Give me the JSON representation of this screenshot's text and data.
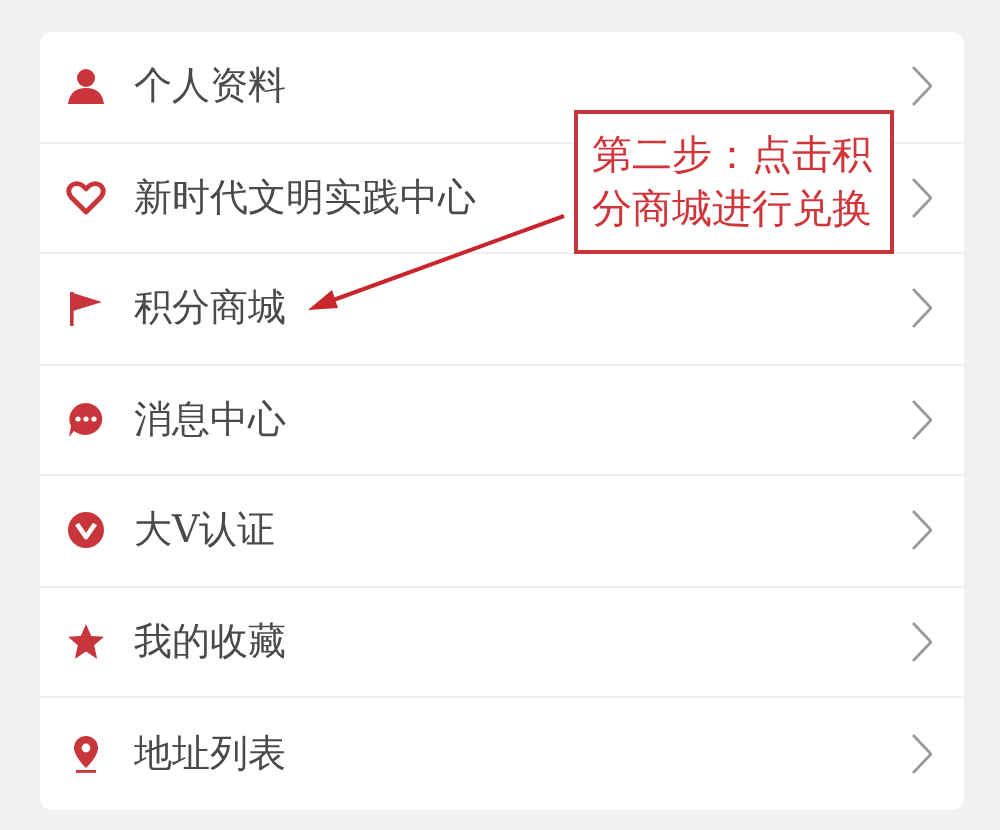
{
  "menu": {
    "items": [
      {
        "label": "个人资料"
      },
      {
        "label": "新时代文明实践中心"
      },
      {
        "label": "积分商城"
      },
      {
        "label": "消息中心"
      },
      {
        "label": "大V认证"
      },
      {
        "label": "我的收藏"
      },
      {
        "label": "地址列表"
      }
    ]
  },
  "annotation": {
    "text": "第二步：点击积分商城进行兑换"
  }
}
